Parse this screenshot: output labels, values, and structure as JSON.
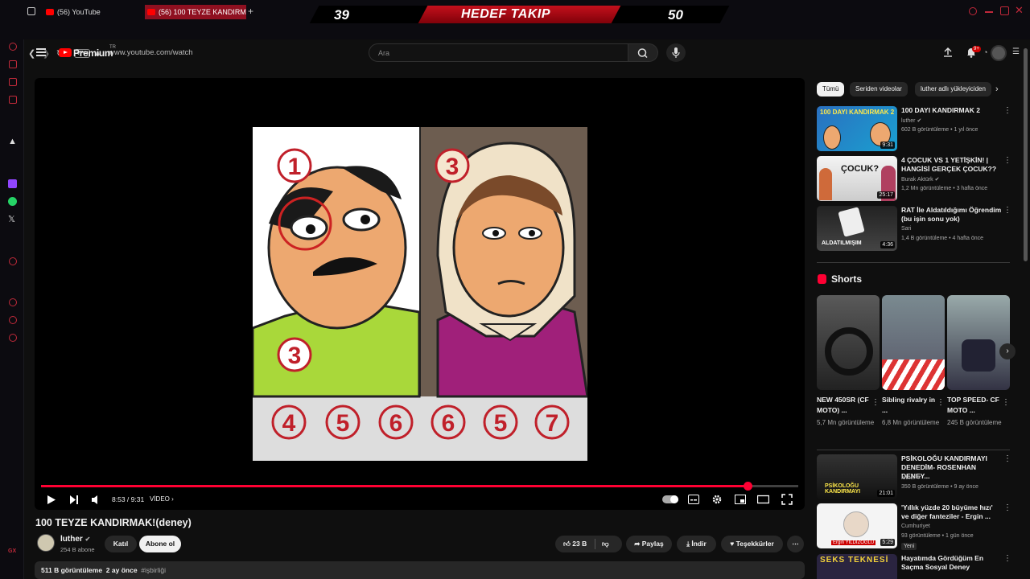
{
  "browser": {
    "tabs": [
      {
        "label": "(56) YouTube",
        "active": false
      },
      {
        "label": "(56) 100 TEYZE KANDIRM",
        "active": true
      }
    ],
    "url": "www.youtube.com/watch",
    "vpn_label": "VPN",
    "banner": {
      "left": "39",
      "title": "HEDEF TAKIP",
      "right": "50"
    }
  },
  "header": {
    "logo": "Premium",
    "region": "TR",
    "search_placeholder": "Ara",
    "notification_count": "9+"
  },
  "player": {
    "time": "8:53 / 9:31",
    "chapter": "VİDEO",
    "progress": 0.933,
    "numbers_top": [
      "1",
      "3"
    ],
    "numbers_mid": [
      "3"
    ],
    "numbers_bottom": [
      "4",
      "5",
      "6",
      "6",
      "5",
      "7"
    ]
  },
  "video": {
    "title": "100 TEYZE KANDIRMAK!(deney)",
    "channel": "luther",
    "subscribers": "254 B abone",
    "join_label": "Katıl",
    "subscribe_label": "Abone ol",
    "likes": "23 B",
    "share_label": "Paylaş",
    "download_label": "İndir",
    "thanks_label": "Teşekkürler",
    "views": "511 B görüntüleme",
    "age": "2 ay önce",
    "hashtag": "#işbirliği"
  },
  "sidebar": {
    "chips": [
      "Tümü",
      "Seriden videolar",
      "luther adlı yükleyiciden"
    ],
    "videos": [
      {
        "title": "100 DAYI KANDIRMAK 2",
        "channel": "luther",
        "meta": "602 B görüntüleme • 1 yıl önce",
        "duration": "9:31",
        "thumb_text": "100 DAYI KANDIRMAK 2"
      },
      {
        "title": "4 ÇOCUK VS 1 YETİŞKİN! | HANGİSİ GERÇEK ÇOCUK??",
        "channel": "Burak Aktürk",
        "meta": "1,2 Mn görüntüleme • 3 hafta önce",
        "duration": "25:17",
        "thumb_text": "ÇOCUK?"
      },
      {
        "title": "RAT İle Aldatıldığımı Öğrendim (bu işin sonu yok)",
        "channel": "Sari",
        "meta": "1,4 B görüntüleme • 4 hafta önce",
        "duration": "4:36",
        "thumb_text": "ALDATILMIŞIM"
      }
    ],
    "shorts_title": "Shorts",
    "shorts": [
      {
        "title": "NEW 450SR (CF MOTO) ...",
        "views": "5,7 Mn görüntüleme"
      },
      {
        "title": "Sibling rivalry in ...",
        "views": "6,8 Mn görüntüleme"
      },
      {
        "title": "TOP SPEED- CF MOTO ...",
        "views": "245 B görüntüleme"
      }
    ],
    "more_videos": [
      {
        "title": "PSİKOLOĞU KANDIRMAYI DENEDİM- ROSENHAN DENEY...",
        "channel": "luther",
        "meta": "350 B görüntüleme • 9 ay önce",
        "duration": "21:01",
        "thumb_text": "PSİKOLOĞU KANDIRMAYI"
      },
      {
        "title": "'Yıllık yüzde 20 büyüme hızı' ve diğer fanteziler - Ergin ...",
        "channel": "Cumhuriyet",
        "meta": "93 görüntüleme • 1 gün önce",
        "duration": "5:29",
        "thumb_text": "Ergin YILDIZOĞLU",
        "badge": "Yeni"
      },
      {
        "title": "Hayatımda Gördüğüm En Saçma Sosyal Deney",
        "channel": "",
        "meta": "",
        "duration": "",
        "thumb_text": "SEKS TEKNESİ"
      }
    ]
  },
  "colors": {
    "accent": "#ff0033",
    "banner_red": "#c4101c",
    "opera_red": "#c0283a"
  }
}
